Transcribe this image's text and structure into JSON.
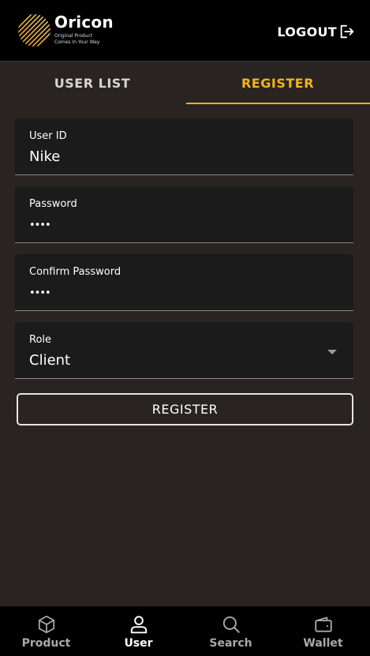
{
  "header": {
    "brand_name": "Oricon",
    "brand_tagline_line1": "Original Product",
    "brand_tagline_line2": "Comes In Your Way",
    "logout_label": "LOGOUT",
    "logout_icon": "logout-icon"
  },
  "tabs": [
    {
      "label": "USER LIST",
      "active": false
    },
    {
      "label": "REGISTER",
      "active": true
    }
  ],
  "form": {
    "user_id": {
      "label": "User ID",
      "value": "Nike"
    },
    "password": {
      "label": "Password",
      "value": "••••"
    },
    "confirm_password": {
      "label": "Confirm Password",
      "value": "••••"
    },
    "role": {
      "label": "Role",
      "value": "Client"
    },
    "submit_label": "REGISTER"
  },
  "bottom_nav": [
    {
      "label": "Product",
      "icon": "box-icon",
      "active": false
    },
    {
      "label": "User",
      "icon": "user-icon",
      "active": true
    },
    {
      "label": "Search",
      "icon": "search-icon",
      "active": false
    },
    {
      "label": "Wallet",
      "icon": "wallet-icon",
      "active": false
    }
  ],
  "colors": {
    "accent": "#f4b41a",
    "background": "#292322",
    "header_bg": "#000000",
    "field_bg": "#1b1b1b"
  }
}
